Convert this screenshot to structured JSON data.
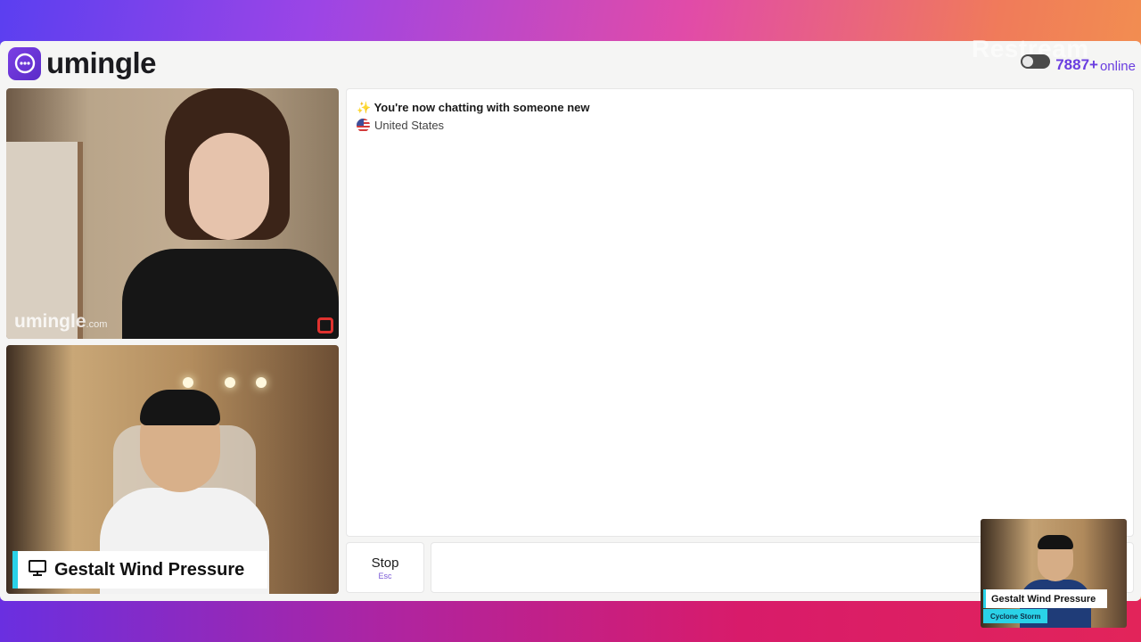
{
  "app": {
    "name": "umingle",
    "online_count": "7887+",
    "online_label": "online",
    "overlay_watermark": "Restream"
  },
  "stranger_video": {
    "watermark_brand": "umingle",
    "watermark_tld": ".com"
  },
  "self_video": {
    "nameplate": "Gestalt Wind Pressure"
  },
  "chat": {
    "status": "✨ You're now chatting with someone new",
    "country": "United States"
  },
  "controls": {
    "stop_label": "Stop",
    "stop_hint": "Esc",
    "message_value": ""
  },
  "pip": {
    "name": "Gestalt Wind Pressure",
    "subtitle": "Cyclone Storm"
  },
  "colors": {
    "brand_purple": "#6a3ee0",
    "nameplate_accent": "#2ad2e8"
  }
}
